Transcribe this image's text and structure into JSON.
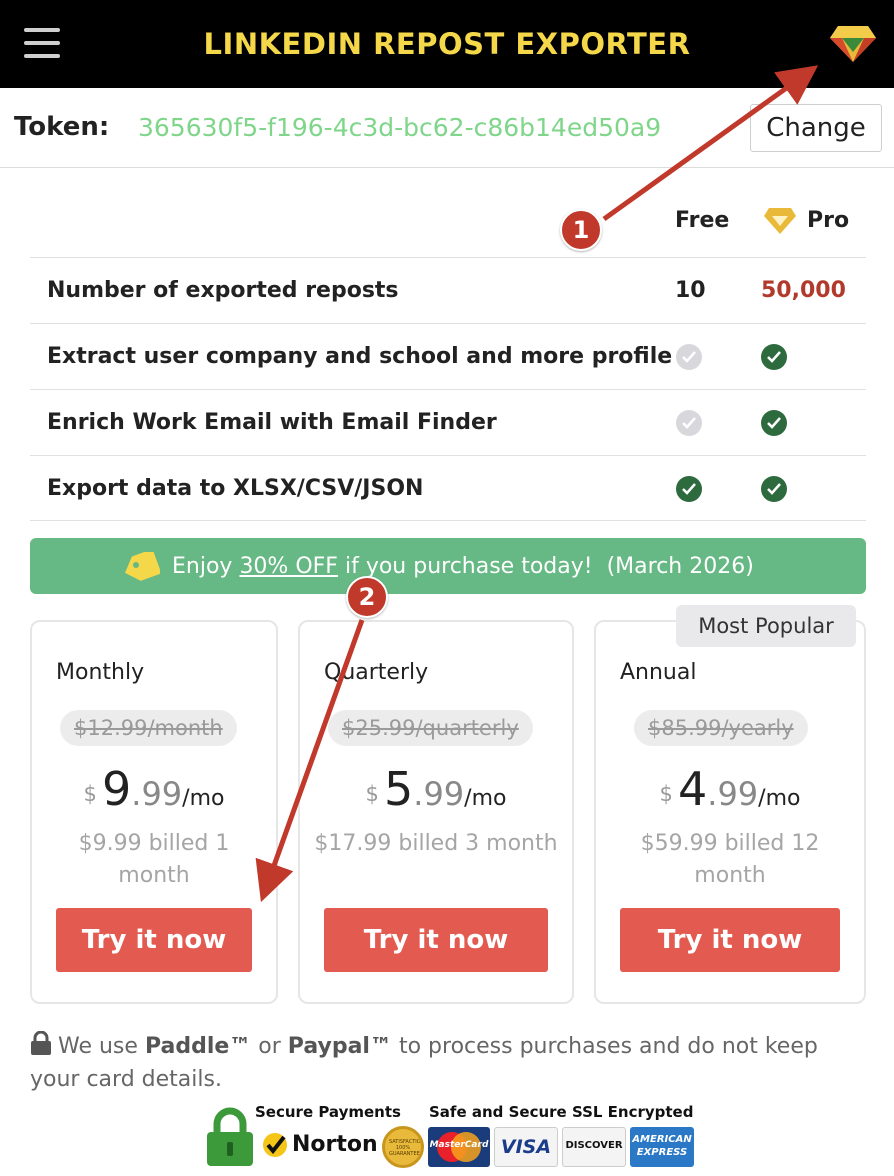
{
  "header": {
    "title": "LINKEDIN REPOST EXPORTER",
    "menu_icon": "hamburger-menu-icon",
    "pro_icon": "diamond-gem-icon"
  },
  "token": {
    "label": "Token:",
    "value": "365630f5-f196-4c3d-bc62-c86b14ed50a9",
    "change_label": "Change"
  },
  "comparison": {
    "columns": {
      "free": "Free",
      "pro": "Pro"
    },
    "rows": [
      {
        "feature": "Number of exported reposts",
        "free": "10",
        "pro": "50,000"
      },
      {
        "feature": "Extract user company and school and more profile",
        "free": "unavailable",
        "pro": "included"
      },
      {
        "feature": "Enrich Work Email with Email Finder",
        "free": "unavailable",
        "pro": "included"
      },
      {
        "feature": "Export data to XLSX/CSV/JSON",
        "free": "included",
        "pro": "included"
      }
    ]
  },
  "promo": {
    "prefix": "Enjoy ",
    "discount": "30% OFF",
    "suffix": " if you purchase today!",
    "date": "(March 2026)",
    "icon": "price-tag-icon"
  },
  "plans": [
    {
      "name": "Monthly",
      "old_price": "$12.99/month",
      "currency": "$",
      "price_int": "9",
      "price_dec": ".99",
      "per": "/mo",
      "billed": "$9.99 billed 1 month",
      "cta": "Try it now"
    },
    {
      "name": "Quarterly",
      "old_price": "$25.99/quarterly",
      "currency": "$",
      "price_int": "5",
      "price_dec": ".99",
      "per": "/mo",
      "billed": "$17.99 billed 3 month",
      "cta": "Try it now"
    },
    {
      "name": "Annual",
      "old_price": "$85.99/yearly",
      "currency": "$",
      "price_int": "4",
      "price_dec": ".99",
      "per": "/mo",
      "billed": "$59.99 billed 12 month",
      "cta": "Try it now",
      "badge": "Most Popular"
    }
  ],
  "footer": {
    "note_pre": "We use ",
    "paddle": "Paddle™",
    "note_or": " or ",
    "paypal": "Paypal™",
    "note_post": " to process purchases and do not keep your card details.",
    "secure_payments": "Secure Payments",
    "ssl": "Safe and Secure SSL Encrypted",
    "norton": "Norton",
    "norton_seal": "SATISFACTION 100% GUARANTEE",
    "cards": [
      "MasterCard",
      "VISA",
      "DISCOVER",
      "AMERICAN EXPRESS"
    ]
  },
  "annotations": [
    {
      "step": "1",
      "target": "pro-gem-icon"
    },
    {
      "step": "2",
      "target": "try-it-now-button-monthly"
    }
  ],
  "colors": {
    "header_bg": "#000000",
    "title": "#f5d74a",
    "token": "#7fd68a",
    "pro_value": "#b23a2c",
    "promo_bg": "#66b884",
    "cta": "#e35b50",
    "check_green": "#2d6a3e",
    "annotation": "#c0392b"
  }
}
